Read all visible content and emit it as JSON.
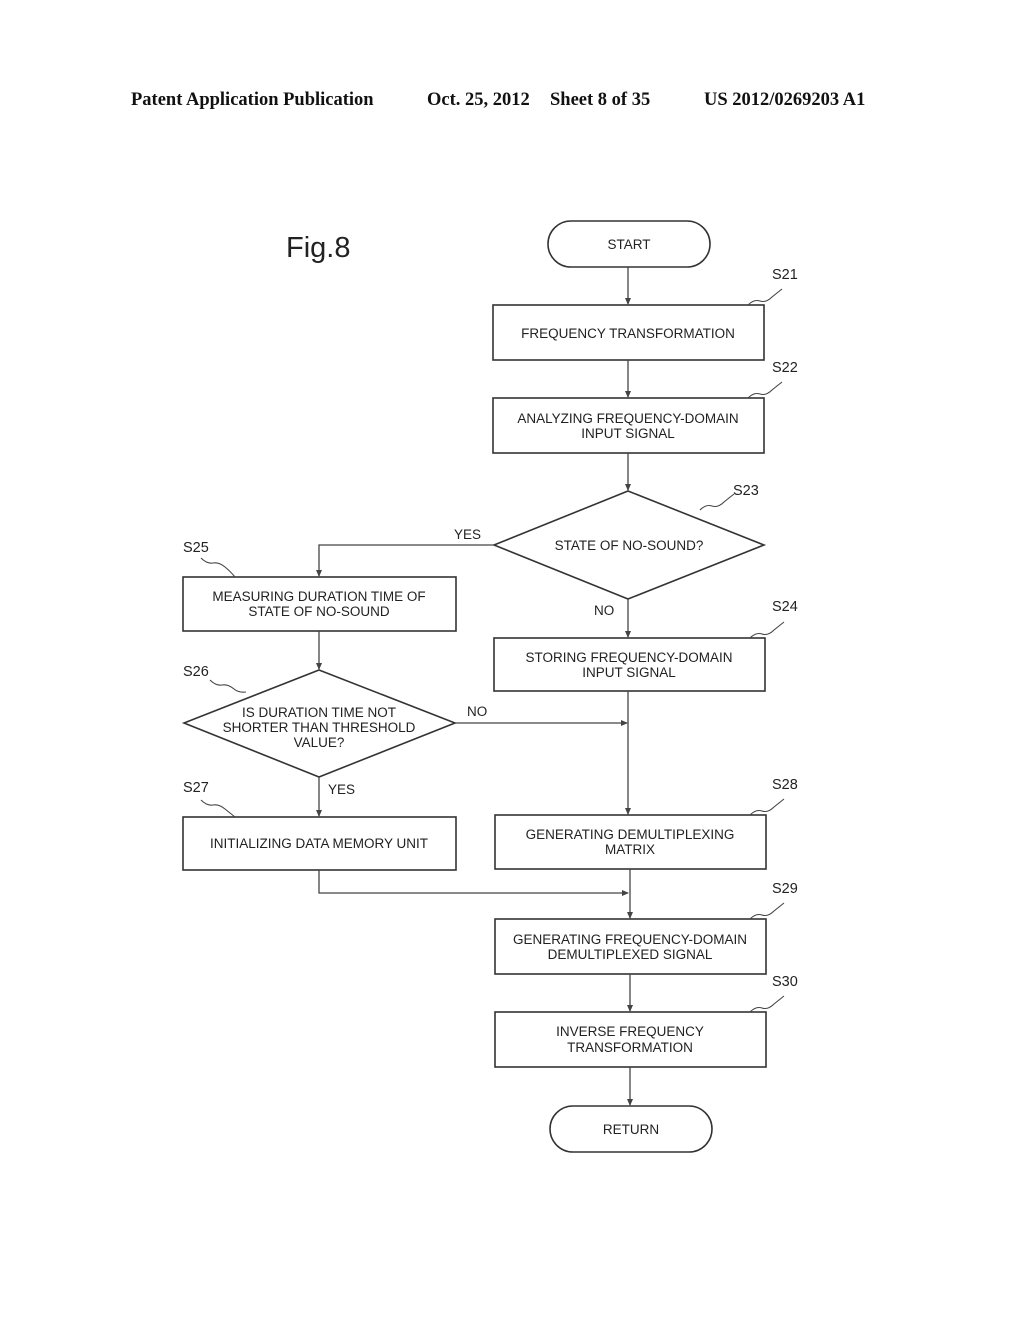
{
  "header": {
    "publication": "Patent Application Publication",
    "date": "Oct. 25, 2012",
    "sheet": "Sheet 8 of 35",
    "number": "US 2012/0269203 A1"
  },
  "figure": {
    "title": "Fig.8",
    "terminals": {
      "start": "START",
      "return": "RETURN"
    },
    "steps": {
      "s21": {
        "id": "S21",
        "lines": [
          "FREQUENCY TRANSFORMATION"
        ]
      },
      "s22": {
        "id": "S22",
        "lines": [
          "ANALYZING FREQUENCY-DOMAIN",
          "INPUT SIGNAL"
        ]
      },
      "s23": {
        "id": "S23",
        "lines": [
          "STATE OF NO-SOUND?"
        ]
      },
      "s24": {
        "id": "S24",
        "lines": [
          "STORING FREQUENCY-DOMAIN",
          "INPUT SIGNAL"
        ]
      },
      "s25": {
        "id": "S25",
        "lines": [
          "MEASURING DURATION TIME OF",
          "STATE OF NO-SOUND"
        ]
      },
      "s26": {
        "id": "S26",
        "lines": [
          "IS DURATION TIME NOT",
          "SHORTER THAN THRESHOLD",
          "VALUE?"
        ]
      },
      "s27": {
        "id": "S27",
        "lines": [
          "INITIALIZING DATA MEMORY UNIT"
        ]
      },
      "s28": {
        "id": "S28",
        "lines": [
          "GENERATING DEMULTIPLEXING",
          "MATRIX"
        ]
      },
      "s29": {
        "id": "S29",
        "lines": [
          "GENERATING FREQUENCY-DOMAIN",
          "DEMULTIPLEXED SIGNAL"
        ]
      },
      "s30": {
        "id": "S30",
        "lines": [
          "INVERSE FREQUENCY",
          "TRANSFORMATION"
        ]
      }
    },
    "branch_labels": {
      "s23_yes": "YES",
      "s23_no": "NO",
      "s26_no": "NO",
      "s26_yes": "YES"
    }
  }
}
